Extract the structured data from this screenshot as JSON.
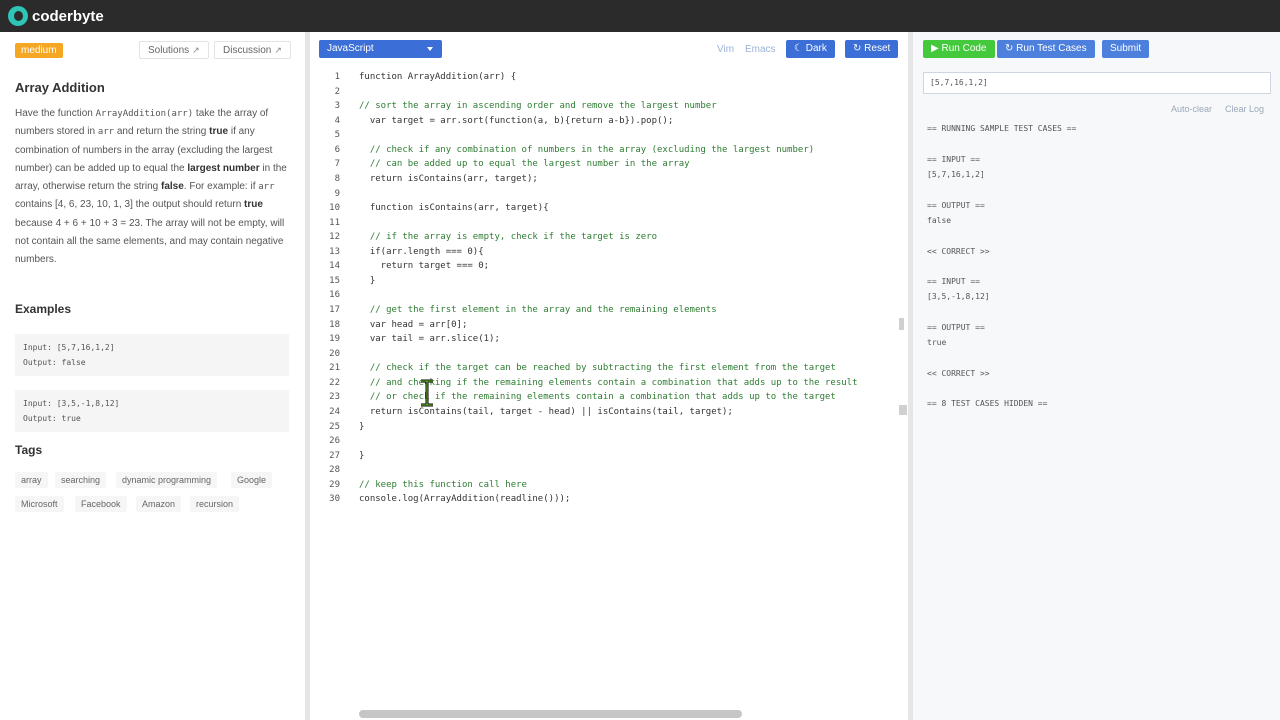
{
  "brand": {
    "name": "coderbyte"
  },
  "left": {
    "difficulty": "medium",
    "solutions_label": "Solutions",
    "discussion_label": "Discussion",
    "title": "Array Addition",
    "desc": {
      "t1": "Have the function ",
      "fn": "ArrayAddition(arr)",
      "t2": " take the array of numbers stored in ",
      "arr": "arr",
      "t3": " and return the string ",
      "true1": "true",
      "t4": " if any combination of numbers in the array (excluding the largest number) can be added up to equal the ",
      "largest": "largest number",
      "t5": " in the array, otherwise return the string ",
      "false1": "false",
      "t6": ". For example: if ",
      "arr2": "arr",
      "t7": " contains [4, 6, 23, 10, 1, 3] the output should return ",
      "true2": "true",
      "t8": " because 4 + 6 + 10 + 3 = 23. The array will not be empty, will not contain all the same elements, and may contain negative numbers."
    },
    "examples_heading": "Examples",
    "examples": [
      {
        "input": "Input: [5,7,16,1,2]",
        "output": "Output: false"
      },
      {
        "input": "Input: [3,5,-1,8,12]",
        "output": "Output: true"
      }
    ],
    "tags_heading": "Tags",
    "tags": [
      "array",
      "searching",
      "dynamic programming",
      "Google",
      "Microsoft",
      "Facebook",
      "Amazon",
      "recursion"
    ]
  },
  "editor": {
    "language": "JavaScript",
    "vim_label": "Vim",
    "emacs_label": "Emacs",
    "dark_label": "Dark",
    "reset_label": "Reset",
    "lines": [
      "function ArrayAddition(arr) {",
      "",
      "// sort the array in ascending order and remove the largest number",
      "  var target = arr.sort(function(a, b){return a-b}).pop();",
      "",
      "  // check if any combination of numbers in the array (excluding the largest number)",
      "  // can be added up to equal the largest number in the array",
      "  return isContains(arr, target);",
      "",
      "  function isContains(arr, target){",
      "",
      "  // if the array is empty, check if the target is zero",
      "  if(arr.length === 0){",
      "    return target === 0;",
      "  }",
      "",
      "  // get the first element in the array and the remaining elements",
      "  var head = arr[0];",
      "  var tail = arr.slice(1);",
      "",
      "  // check if the target can be reached by subtracting the first element from the target",
      "  // and checking if the remaining elements contain a combination that adds up to the result",
      "  // or check if the remaining elements contain a combination that adds up to the target",
      "  return isContains(tail, target - head) || isContains(tail, target);",
      "}",
      "",
      "}",
      "",
      "// keep this function call here",
      "console.log(ArrayAddition(readline()));"
    ]
  },
  "right": {
    "run_code": "Run Code",
    "run_tests": "Run Test Cases",
    "submit": "Submit",
    "input_value": "[5,7,16,1,2]",
    "auto_clear": "Auto-clear",
    "clear_log": "Clear Log",
    "output": [
      "== RUNNING SAMPLE TEST CASES ==",
      "== INPUT ==",
      "[5,7,16,1,2]",
      "== OUTPUT ==",
      "false",
      "<< CORRECT >>",
      "== INPUT ==",
      "[3,5,-1,8,12]",
      "== OUTPUT ==",
      "true",
      "<< CORRECT >>",
      "== 8 TEST CASES HIDDEN =="
    ]
  }
}
